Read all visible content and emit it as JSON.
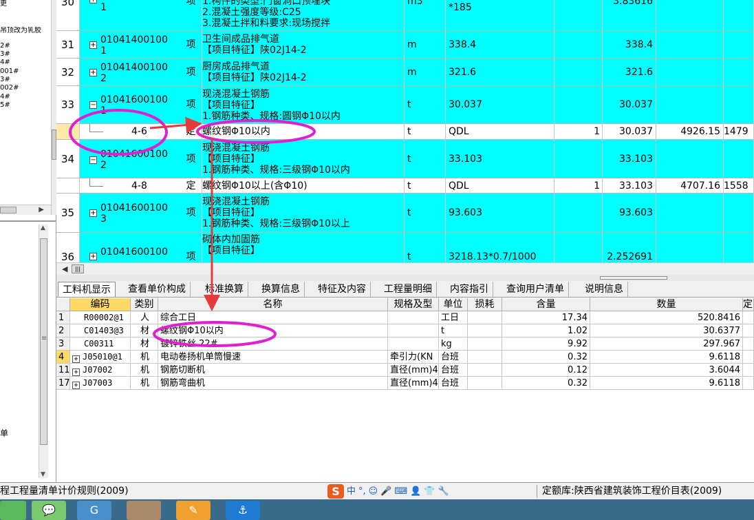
{
  "left_panel": {
    "tree_lines": [
      "更",
      "",
      "吊顶改为乳胶",
      "",
      "2#",
      "3#",
      "4#",
      "001#",
      "3#",
      "002#",
      "4#",
      "5#"
    ],
    "lower_label": "单"
  },
  "grid": {
    "rows": [
      {
        "num": "30",
        "code1": "1",
        "unit_type": "项",
        "desc": [
          "1.构件的类型:门窗洞口预埋块",
          "2.混凝土强度等级:C25",
          "3.混凝土拌和料要求:现场搅拌"
        ],
        "unit": "m3",
        "expr": "*185",
        "qty": "",
        "qty2": "3.83616",
        "price": "",
        "total": ""
      },
      {
        "num": "31",
        "code1": "01041400100",
        "code2": "1",
        "unit_type": "项",
        "desc": [
          "卫生间成品排气道",
          "【项目特征】陕02J14-2"
        ],
        "unit": "m",
        "expr": "338.4",
        "qty": "",
        "qty2": "338.4",
        "price": "",
        "total": ""
      },
      {
        "num": "32",
        "code1": "01041400100",
        "code2": "2",
        "unit_type": "项",
        "desc": [
          "厨房成品排气道",
          "【项目特征】陕02J14-2"
        ],
        "unit": "m",
        "expr": "321.6",
        "qty": "",
        "qty2": "321.6",
        "price": "",
        "total": ""
      },
      {
        "num": "33",
        "code1": "01041600100",
        "code2": "1",
        "unit_type": "项",
        "desc": [
          "现浇混凝土钢筋",
          "【项目特征】",
          "1.钢筋种类、规格:圆钢Φ10以内"
        ],
        "unit": "t",
        "expr": "30.037",
        "qty": "",
        "qty2": "30.037",
        "price": "",
        "total": ""
      },
      {
        "num": "",
        "code1": "4-6",
        "unit_type": "定",
        "desc": [
          "螺纹钢Φ10以内"
        ],
        "unit": "t",
        "expr": "QDL",
        "qty": "1",
        "qty2": "30.037",
        "price": "4926.15",
        "total": "1479"
      },
      {
        "num": "34",
        "code1": "01041600100",
        "code2": "2",
        "unit_type": "项",
        "desc": [
          "现浇混凝土钢筋",
          "【项目特征】",
          "1.钢筋种类、规格:三级钢Φ10以内"
        ],
        "unit": "t",
        "expr": "33.103",
        "qty": "",
        "qty2": "33.103",
        "price": "",
        "total": ""
      },
      {
        "num": "",
        "code1": "4-8",
        "unit_type": "定",
        "desc": [
          "螺纹钢Φ10以上(含Φ10)"
        ],
        "unit": "t",
        "expr": "QDL",
        "qty": "1",
        "qty2": "33.103",
        "price": "4707.16",
        "total": "1558"
      },
      {
        "num": "35",
        "code1": "01041600100",
        "code2": "3",
        "unit_type": "项",
        "desc": [
          "现浇混凝土钢筋",
          "【项目特征】",
          "1.钢筋种类、规格:三级钢Φ10以上"
        ],
        "unit": "t",
        "expr": "93.603",
        "qty": "",
        "qty2": "93.603",
        "price": "",
        "total": ""
      },
      {
        "num": "36",
        "code1": "01041600100",
        "code2": "",
        "unit_type": "项",
        "desc": [
          "砌体内加固筋",
          "【项目特征】",
          ""
        ],
        "unit": "t",
        "expr": "3218.13*0.7/1000",
        "qty": "",
        "qty2": "2.252691",
        "price": "",
        "total": ""
      }
    ]
  },
  "tabs": [
    "工料机显示",
    "查看单价构成",
    "标准换算",
    "换算信息",
    "特征及内容",
    "工程量明细",
    "内容指引",
    "查询用户清单",
    "说明信息"
  ],
  "bottom_table": {
    "headers": [
      "编码",
      "类别",
      "名称",
      "规格及型",
      "单位",
      "损耗",
      "含量",
      "数量",
      "定"
    ],
    "rows": [
      {
        "no": "1",
        "exp": "",
        "code": "R00002@1",
        "cat": "人",
        "name": "综合工日",
        "spec": "",
        "unit": "工日",
        "loss": "",
        "content": "17.34",
        "qty": "520.8416"
      },
      {
        "no": "2",
        "exp": "",
        "code": "C01403@3",
        "cat": "材",
        "name": "螺纹钢Φ10以内",
        "spec": "",
        "unit": "t",
        "loss": "",
        "content": "1.02",
        "qty": "30.6377"
      },
      {
        "no": "3",
        "exp": "",
        "code": "C00311",
        "cat": "材",
        "name": "镀锌铁丝 22#",
        "spec": "",
        "unit": "kg",
        "loss": "",
        "content": "9.92",
        "qty": "297.967"
      },
      {
        "no": "4",
        "exp": "+",
        "code": "J05010@1",
        "cat": "机",
        "name": "电动卷扬机单筒慢速",
        "spec": "牵引力(KN",
        "unit": "台班",
        "loss": "",
        "content": "0.32",
        "qty": "9.6118"
      },
      {
        "no": "11",
        "exp": "+",
        "code": "J07002",
        "cat": "机",
        "name": "钢筋切断机",
        "spec": "直径(mm)4",
        "unit": "台班",
        "loss": "",
        "content": "0.12",
        "qty": "3.6044"
      },
      {
        "no": "17",
        "exp": "+",
        "code": "J07003",
        "cat": "机",
        "name": "钢筋弯曲机",
        "spec": "直径(mm)4",
        "unit": "台班",
        "loss": "",
        "content": "0.32",
        "qty": "9.6118"
      }
    ]
  },
  "status": {
    "left": "程工程量清单计价规则(2009)",
    "right": "定额库:陕西省建筑装饰工程价目表(2009)",
    "ime_label": "中"
  },
  "colors": {
    "row_cyan": "#00ffff",
    "annotation": "#e020d0",
    "selected_header": "#ffd966"
  }
}
